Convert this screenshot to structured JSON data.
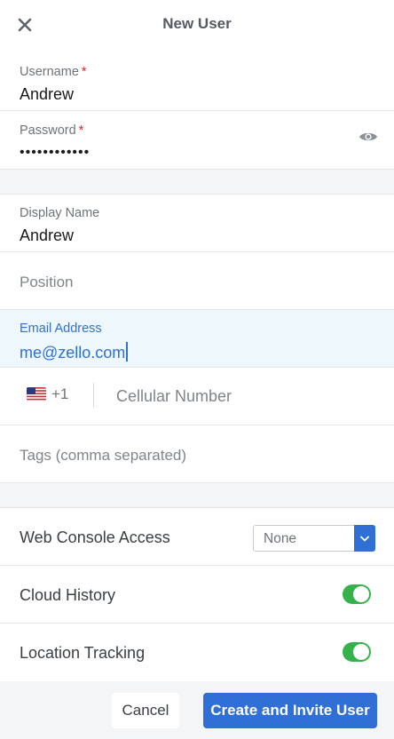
{
  "header": {
    "title": "New User",
    "close_icon": "close-icon"
  },
  "form": {
    "username": {
      "label": "Username",
      "required_mark": "*",
      "value": "Andrew"
    },
    "password": {
      "label": "Password",
      "required_mark": "*",
      "value": "••••••••••••",
      "toggle_icon": "eye-icon"
    },
    "display_name": {
      "label": "Display Name",
      "value": "Andrew"
    },
    "position": {
      "placeholder": "Position"
    },
    "email": {
      "label": "Email Address",
      "value": "me@zello.com"
    },
    "phone": {
      "flag_icon": "us-flag-icon",
      "country_code": "+1",
      "placeholder": "Cellular Number"
    },
    "tags": {
      "placeholder": "Tags (comma separated)"
    }
  },
  "settings": {
    "web_console": {
      "label": "Web Console Access",
      "selected": "None"
    },
    "cloud_history": {
      "label": "Cloud History",
      "enabled": true
    },
    "location_tracking": {
      "label": "Location Tracking",
      "enabled": true
    }
  },
  "footer": {
    "cancel_label": "Cancel",
    "create_label": "Create and Invite User"
  },
  "colors": {
    "accent": "#2f6fd6",
    "toggle_on": "#35b34a",
    "required": "#e0242b"
  }
}
